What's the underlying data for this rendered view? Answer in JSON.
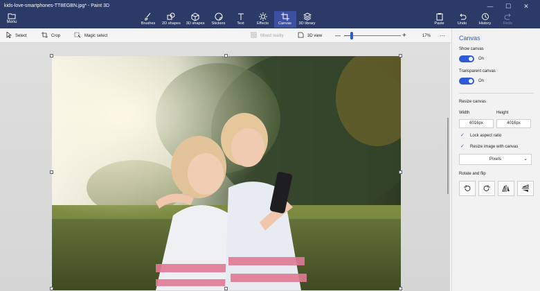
{
  "window": {
    "title": "kids-love-smartphones-TT8EGBN.jpg* - Paint 3D",
    "controls": [
      "—",
      "☐",
      "✕"
    ]
  },
  "ribbon": {
    "menu_label": "Menu",
    "tools": [
      {
        "label": "Brushes",
        "icon": "brush-icon"
      },
      {
        "label": "2D shapes",
        "icon": "2d-shapes-icon"
      },
      {
        "label": "3D shapes",
        "icon": "3d-shapes-icon"
      },
      {
        "label": "Stickers",
        "icon": "stickers-icon"
      },
      {
        "label": "Text",
        "icon": "text-icon"
      },
      {
        "label": "Effects",
        "icon": "effects-icon"
      },
      {
        "label": "Canvas",
        "icon": "canvas-icon",
        "active": true
      },
      {
        "label": "3D library",
        "icon": "3d-library-icon"
      }
    ],
    "right_tools": [
      {
        "label": "Paste",
        "icon": "paste-icon"
      },
      {
        "label": "Undo",
        "icon": "undo-icon"
      },
      {
        "label": "History",
        "icon": "history-icon"
      },
      {
        "label": "Redo",
        "icon": "redo-icon",
        "disabled": true
      }
    ]
  },
  "toolbar": {
    "select": "Select",
    "crop": "Crop",
    "magic_select": "Magic select",
    "mixed_reality": "Mixed reality",
    "view_3d": "3D view",
    "zoom_minus": "—",
    "zoom_plus": "+",
    "zoom_percent": "17%",
    "zoom_fraction": 0.13,
    "more": "···"
  },
  "panel": {
    "title": "Canvas",
    "show_canvas_label": "Show canvas",
    "show_canvas_state": "On",
    "transparent_canvas_label": "Transparent canvas",
    "transparent_canvas_state": "On",
    "resize_canvas_label": "Resize canvas",
    "width_label": "Width",
    "height_label": "Height",
    "width_value": "6016px",
    "height_value": "4016px",
    "lock_aspect_label": "Lock aspect ratio",
    "resize_image_label": "Resize image with canvas",
    "units_selected": "Pixels",
    "rotate_flip_label": "Rotate and flip"
  },
  "colors": {
    "ribbon": "#2b3a67",
    "accent": "#2b5bd7"
  }
}
